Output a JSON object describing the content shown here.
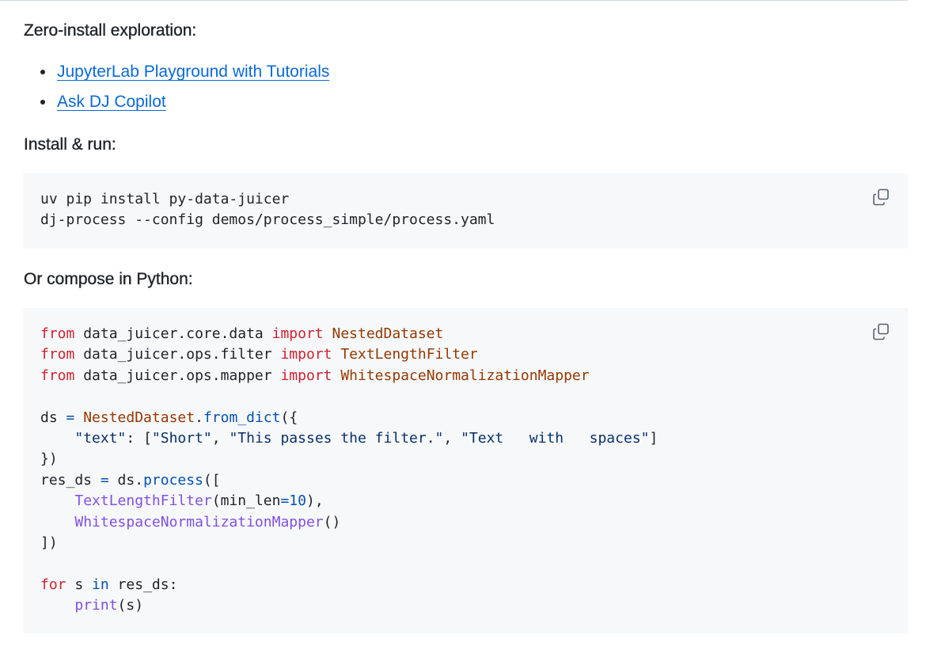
{
  "sections": {
    "zero_install_heading": "Zero-install exploration:",
    "links": [
      {
        "label": "JupyterLab Playground with Tutorials"
      },
      {
        "label": "Ask DJ Copilot"
      }
    ],
    "install_heading": "Install & run:",
    "python_heading": "Or compose in Python:"
  },
  "install_code": {
    "line1": "uv pip install py-data-juicer",
    "line2": "dj-process --config demos/process_simple/process.yaml"
  },
  "python_code": {
    "l1": {
      "kw1": "from",
      "mod": " data_juicer.core.data ",
      "kw2": "import",
      "cls": " NestedDataset"
    },
    "l2": {
      "kw1": "from",
      "mod": " data_juicer.ops.filter ",
      "kw2": "import",
      "cls": " TextLengthFilter"
    },
    "l3": {
      "kw1": "from",
      "mod": " data_juicer.ops.mapper ",
      "kw2": "import",
      "cls": " WhitespaceNormalizationMapper"
    },
    "l5": {
      "var": "ds ",
      "op": "=",
      "sp": " ",
      "cls": "NestedDataset",
      "dot": ".",
      "fn": "from_dict",
      "rest": "({"
    },
    "l6": {
      "indent": "    ",
      "str1": "\"text\"",
      "mid1": ": [",
      "str2": "\"Short\"",
      "sep1": ", ",
      "str3": "\"This passes the filter.\"",
      "sep2": ", ",
      "str4": "\"Text   with   spaces\"",
      "end": "]"
    },
    "l7": {
      "text": "})"
    },
    "l8": {
      "var": "res_ds ",
      "op": "=",
      "mid": " ds.",
      "fn": "process",
      "rest": "(["
    },
    "l9": {
      "indent": "    ",
      "fn": "TextLengthFilter",
      "open": "(min_len",
      "op": "=",
      "num": "10",
      "close": "),"
    },
    "l10": {
      "indent": "    ",
      "fn": "WhitespaceNormalizationMapper",
      "close": "()"
    },
    "l11": {
      "text": "])"
    },
    "l13": {
      "kw1": "for",
      "mid1": " s ",
      "kw2": "in",
      "rest": " res_ds:"
    },
    "l14": {
      "indent": "    ",
      "fn": "print",
      "rest": "(s)"
    }
  },
  "icons": {
    "copy": "copy-icon"
  },
  "colors": {
    "link": "#0969da",
    "code_bg": "#f6f8fa",
    "keyword": "#cf222e",
    "class": "#953800",
    "function": "#8250df",
    "string": "#0a3069",
    "number": "#0550ae"
  }
}
